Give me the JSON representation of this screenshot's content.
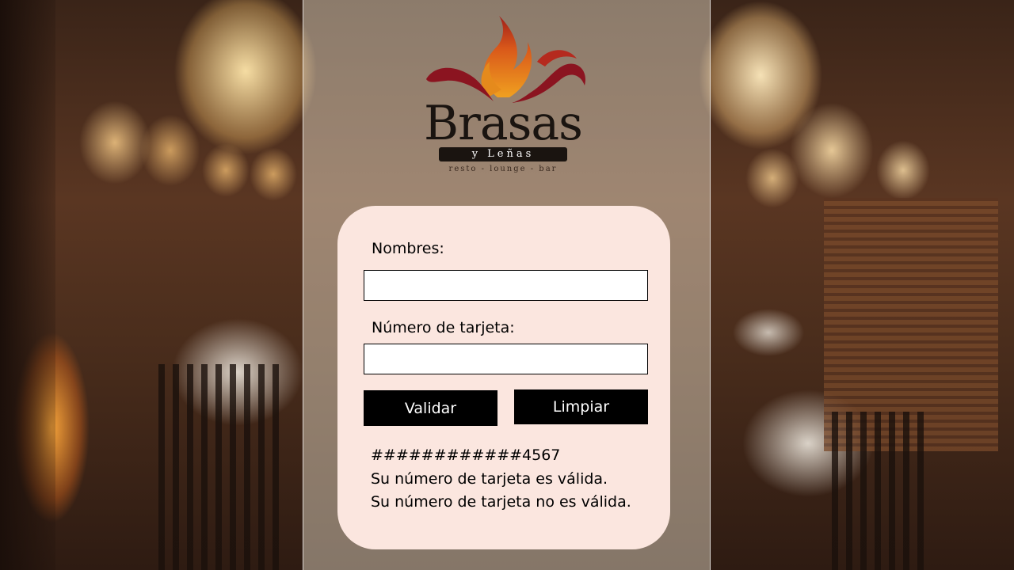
{
  "logo": {
    "name": "Brasas",
    "band": "y Leñas",
    "tagline": "resto - lounge - bar"
  },
  "form": {
    "nombres_label": "Nombres:",
    "nombres_value": "",
    "tarjeta_label": "Número de tarjeta:",
    "tarjeta_value": "",
    "validar_label": "Validar",
    "limpiar_label": "Limpiar"
  },
  "output": {
    "masked_number": "############4567",
    "valid_message": "Su número de tarjeta es válida.",
    "invalid_message": "Su número de tarjeta no es válida."
  },
  "colors": {
    "card_bg": "#fbe6df",
    "button_bg": "#000000",
    "flame_red": "#8b1420",
    "flame_orange": "#e07a1a"
  }
}
